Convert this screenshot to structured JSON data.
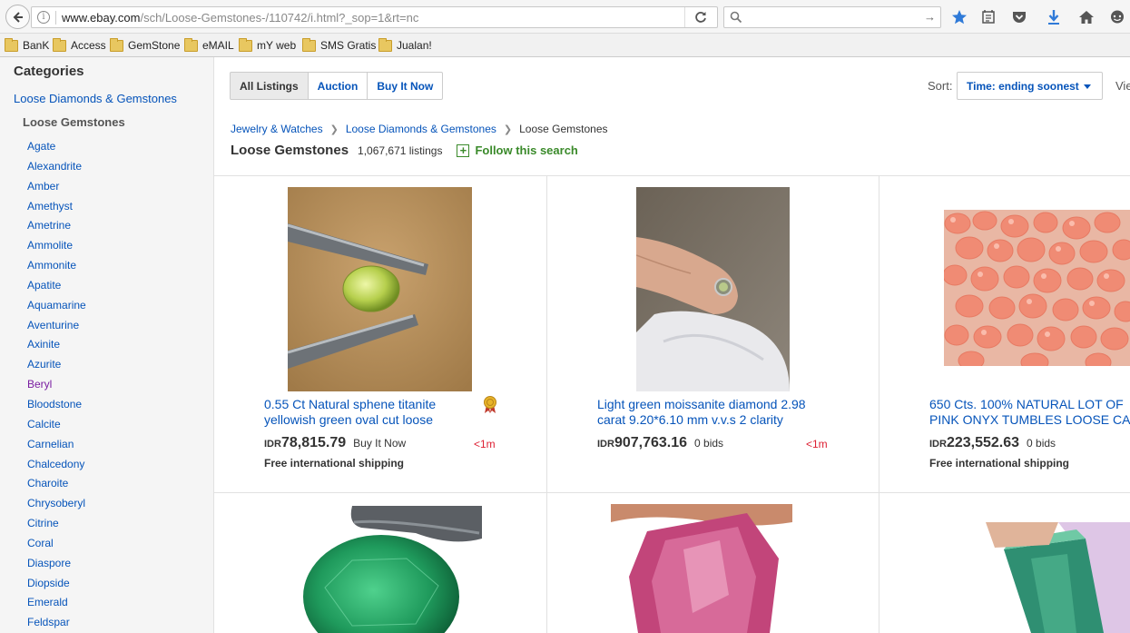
{
  "browser": {
    "url_host": "www.ebay.com",
    "url_path": "/sch/Loose-Gemstones-/110742/i.html?_sop=1&rt=nc"
  },
  "bookmarks": [
    "BanK",
    "Access",
    "GemStone",
    "eMAIL",
    "mY web",
    "SMS Gratis",
    "Jualan!"
  ],
  "sidebar": {
    "heading": "Categories",
    "parent": "Loose Diamonds & Gemstones",
    "current": "Loose Gemstones",
    "items": [
      "Agate",
      "Alexandrite",
      "Amber",
      "Amethyst",
      "Ametrine",
      "Ammolite",
      "Ammonite",
      "Apatite",
      "Aquamarine",
      "Aventurine",
      "Axinite",
      "Azurite",
      "Beryl",
      "Bloodstone",
      "Calcite",
      "Carnelian",
      "Chalcedony",
      "Charoite",
      "Chrysoberyl",
      "Citrine",
      "Coral",
      "Diaspore",
      "Diopside",
      "Emerald",
      "Feldspar"
    ]
  },
  "toolbar": {
    "tabs": [
      "All Listings",
      "Auction",
      "Buy It Now"
    ],
    "sort_label": "Sort:",
    "sort_value": "Time: ending soonest",
    "view_label": "View:"
  },
  "breadcrumb": [
    "Jewelry & Watches",
    "Loose Diamonds & Gemstones",
    "Loose Gemstones"
  ],
  "header": {
    "title": "Loose Gemstones",
    "count": "1,067,671 listings",
    "follow": "Follow this search"
  },
  "listings": [
    {
      "title_line1": "0.55 Ct Natural sphene titanite",
      "title_line2": "yellowish green oval cut loose",
      "currency": "IDR",
      "price": "78,815.79",
      "format": "Buy It Now",
      "time_left": "<1m",
      "shipping": "Free international shipping"
    },
    {
      "title_line1": "Light green moissanite diamond 2.98",
      "title_line2": "carat 9.20*6.10 mm v.v.s 2 clarity",
      "currency": "IDR",
      "price": "907,763.16",
      "format": "0 bids",
      "time_left": "<1m",
      "shipping": ""
    },
    {
      "title_line1": "650 Cts. 100% NATURAL LOT OF",
      "title_line2": "PINK ONYX TUMBLES LOOSE CAB",
      "currency": "IDR",
      "price": "223,552.63",
      "format": "0 bids",
      "time_left": "",
      "shipping": "Free international shipping"
    }
  ],
  "colors": {
    "link": "#0654ba",
    "visited": "#7a1ea1",
    "time_red": "#dd1e31",
    "follow_green": "#3a8a2a"
  }
}
